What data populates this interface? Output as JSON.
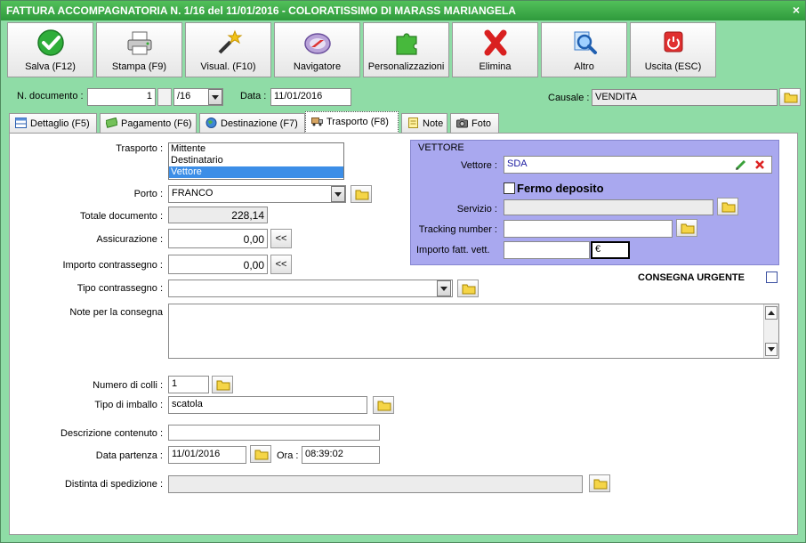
{
  "window": {
    "title": "FATTURA ACCOMPAGNATORIA N. 1/16 del 11/01/2016 - COLORATISSIMO DI MARASS MARIANGELA",
    "close_glyph": "×"
  },
  "toolbar": [
    {
      "label": "Salva (F12)",
      "icon": "check-icon"
    },
    {
      "label": "Stampa (F9)",
      "icon": "printer-icon"
    },
    {
      "label": "Visual. (F10)",
      "icon": "magic-wand-icon"
    },
    {
      "label": "Navigatore",
      "icon": "compass-icon"
    },
    {
      "label": "Personalizzazioni",
      "icon": "puzzle-icon"
    },
    {
      "label": "Elimina",
      "icon": "delete-x-icon"
    },
    {
      "label": "Altro",
      "icon": "magnifier-icon"
    },
    {
      "label": "Uscita (ESC)",
      "icon": "power-icon"
    }
  ],
  "header": {
    "doc_label": "N. documento :",
    "doc_number": "1",
    "doc_suffix": "/16",
    "date_label": "Data :",
    "date_value": "11/01/2016",
    "causale_label": "Causale :",
    "causale_value": "VENDITA"
  },
  "tabs": [
    {
      "label": "Dettaglio (F5)",
      "icon": "table-icon",
      "active": false
    },
    {
      "label": "Pagamento (F6)",
      "icon": "money-icon",
      "active": false
    },
    {
      "label": "Destinazione (F7)",
      "icon": "globe-icon",
      "active": false
    },
    {
      "label": "Trasporto (F8)",
      "icon": "truck-icon",
      "active": true
    },
    {
      "label": "Note",
      "icon": "note-icon",
      "active": false
    },
    {
      "label": "Foto",
      "icon": "camera-icon",
      "active": false
    }
  ],
  "transport": {
    "trasporto_label": "Trasporto :",
    "trasporto_options": [
      "Mittente",
      "Destinatario",
      "Vettore"
    ],
    "trasporto_selected": "Vettore",
    "porto_label": "Porto :",
    "porto_value": "FRANCO",
    "totale_label": "Totale documento :",
    "totale_value": "228,14",
    "assicurazione_label": "Assicurazione :",
    "assicurazione_value": "0,00",
    "contrassegno_label": "Importo contrassegno :",
    "contrassegno_value": "0,00",
    "copy_button": "<<",
    "tipo_contrassegno_label": "Tipo contrassegno :",
    "tipo_contrassegno_value": "",
    "note_label": "Note per la consegna",
    "note_value": "",
    "colli_label": "Numero di colli :",
    "colli_value": "1",
    "imballo_label": "Tipo di imballo :",
    "imballo_value": "scatola",
    "descrizione_label": "Descrizione contenuto :",
    "descrizione_value": "",
    "data_partenza_label": "Data partenza :",
    "data_partenza_value": "11/01/2016",
    "ora_label": "Ora :",
    "ora_value": "08:39:02",
    "distinta_label": "Distinta di spedizione :",
    "distinta_value": ""
  },
  "vettore": {
    "group_title": "VETTORE",
    "vettore_label": "Vettore :",
    "vettore_value": "SDA",
    "fermo_label": "Fermo deposito",
    "servizio_label": "Servizio :",
    "servizio_value": "",
    "tracking_label": "Tracking number :",
    "tracking_value": "",
    "importo_label": "Importo fatt. vett.",
    "importo_value": "",
    "currency": "€"
  },
  "urgent": {
    "label": "CONSEGNA URGENTE"
  },
  "colors": {
    "window_bg": "#8fdca6",
    "title_bg": "#3aa843",
    "vettore_bg": "#a9a8ef",
    "selection": "#3c8ee7",
    "vettore_text": "#1a1aa0"
  }
}
